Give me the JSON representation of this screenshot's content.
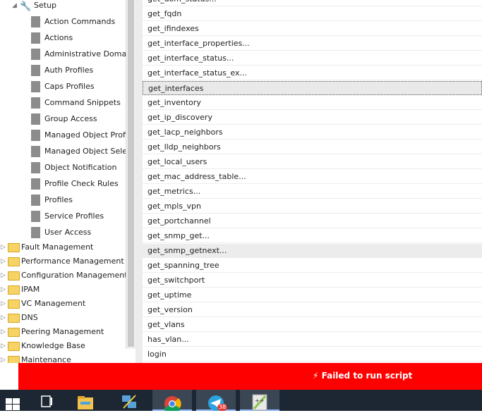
{
  "sidebar": {
    "setup_label": "Setup",
    "setup_children": [
      "Action Commands",
      "Actions",
      "Administrative Domains",
      "Auth Profiles",
      "Caps Profiles",
      "Command Snippets",
      "Group Access",
      "Managed Object Profile",
      "Managed Object Selector",
      "Object Notification",
      "Profile Check Rules",
      "Profiles",
      "Service Profiles",
      "User Access"
    ],
    "folders": [
      "Fault Management",
      "Performance Management",
      "Configuration Management",
      "IPAM",
      "VC Management",
      "DNS",
      "Peering Management",
      "Knowledge Base",
      "Maintenance"
    ]
  },
  "list": {
    "items": [
      "get_dom_status...",
      "get_fqdn",
      "get_ifindexes",
      "get_interface_properties...",
      "get_interface_status...",
      "get_interface_status_ex...",
      "get_interfaces",
      "get_inventory",
      "get_ip_discovery",
      "get_lacp_neighbors",
      "get_lldp_neighbors",
      "get_local_users",
      "get_mac_address_table...",
      "get_metrics...",
      "get_mpls_vpn",
      "get_portchannel",
      "get_snmp_get...",
      "get_snmp_getnext...",
      "get_spanning_tree",
      "get_switchport",
      "get_uptime",
      "get_version",
      "get_vlans",
      "has_vlan...",
      "login"
    ],
    "selected_index": 6,
    "hover_index": 17
  },
  "error": {
    "icon": "bolt-icon",
    "message": "⚡ Failed to run script"
  },
  "taskbar": {
    "telegram_badge": "38"
  },
  "colors": {
    "error_bg": "#ff0000",
    "taskbar_bg": "#1d2733"
  }
}
